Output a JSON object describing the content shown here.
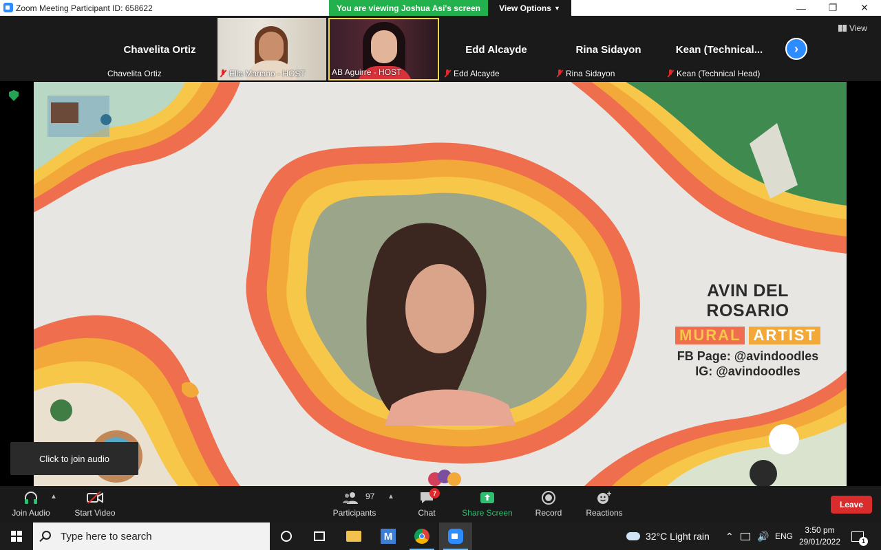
{
  "window": {
    "title": "Zoom Meeting Participant ID: 658622",
    "controls": [
      "minimize-icon",
      "restore-icon",
      "close-icon"
    ]
  },
  "share_banner": {
    "viewing_text": "You are viewing Joshua Asi's screen",
    "view_options_label": "View Options"
  },
  "participants_strip": {
    "tiles": [
      {
        "big_name": "Chavelita Ortiz",
        "caption": "Chavelita Ortiz",
        "muted": false,
        "video": false
      },
      {
        "big_name": "",
        "caption": "Ella Mariano - HOST",
        "muted": true,
        "video": true
      },
      {
        "big_name": "",
        "caption": "AB Aguirre - HOST",
        "muted": false,
        "video": true,
        "active_speaker": true
      },
      {
        "big_name": "Edd Alcayde",
        "caption": "Edd Alcayde",
        "muted": true,
        "video": false
      },
      {
        "big_name": "Rina Sidayon",
        "caption": "Rina Sidayon",
        "muted": true,
        "video": false
      },
      {
        "big_name": "Kean  (Technical...",
        "caption": "Kean (Technical Head)",
        "muted": true,
        "video": false
      }
    ],
    "next_icon": "chevron-right-icon",
    "view_label": "View"
  },
  "shared_screen": {
    "speaker_name": "AVIN DEL ROSARIO",
    "tag_1": "MURAL",
    "tag_2": "ARTIST",
    "fb": "FB Page: @avindoodles",
    "ig": "IG: @avindoodles",
    "colors": {
      "red": "#ef6e4e",
      "orange": "#f3a93a",
      "yellow": "#f7c74a",
      "bg": "#e8e6e2"
    }
  },
  "join_audio_tip": "Click to join audio",
  "toolbar": {
    "join_audio": "Join Audio",
    "start_video": "Start Video",
    "participants": "Participants",
    "participants_count": "97",
    "chat": "Chat",
    "chat_badge": "7",
    "share_screen": "Share Screen",
    "record": "Record",
    "reactions": "Reactions",
    "leave": "Leave"
  },
  "taskbar": {
    "search_placeholder": "Type here to search",
    "weather": "32°C  Light rain",
    "language": "ENG",
    "time": "3:50 pm",
    "date": "29/01/2022",
    "notification_count": "1"
  }
}
